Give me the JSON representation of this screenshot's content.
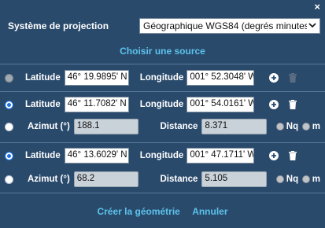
{
  "header": {
    "close_glyph": "×"
  },
  "projection": {
    "label": "Système de projection",
    "selected": "Géographique WGS84 (degrés minutes)",
    "chevron": "⌄"
  },
  "source_link": "Choisir une source",
  "points": [
    {
      "latitude_label": "Latitude",
      "latitude": "46° 19.9895' N",
      "longitude_label": "Longitude",
      "longitude": "001° 52.3048' W",
      "radio_state": "disabled"
    },
    {
      "latitude_label": "Latitude",
      "latitude": "46° 11.7082' N",
      "longitude_label": "Longitude",
      "longitude": "001° 54.0161' W",
      "radio_state": "checked",
      "azimut_label": "Azimut (°)",
      "azimut": "188.1",
      "distance_label": "Distance",
      "distance": "8.371",
      "unit_nq": "Nq",
      "unit_m": "m"
    },
    {
      "latitude_label": "Latitude",
      "latitude": "46° 13.6029' N",
      "longitude_label": "Longitude",
      "longitude": "001° 47.1711' W",
      "radio_state": "checked",
      "azimut_label": "Azimut (°)",
      "azimut": "68.2",
      "distance_label": "Distance",
      "distance": "5.105",
      "unit_nq": "Nq",
      "unit_m": "m"
    }
  ],
  "footer": {
    "create": "Créer la géométrie",
    "cancel": "Annuler"
  },
  "colors": {
    "panel_bg": "#2a4a6c",
    "link": "#5cc3ec"
  }
}
